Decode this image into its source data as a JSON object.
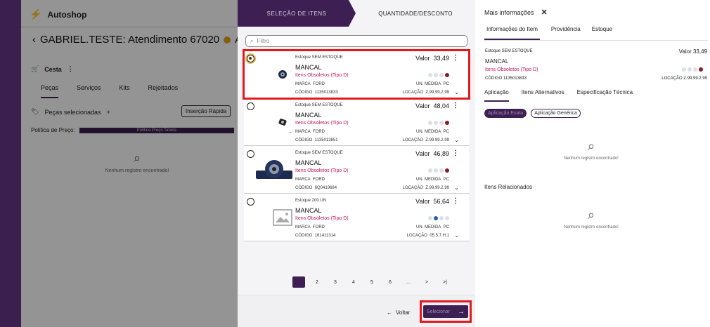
{
  "background": {
    "app_name": "Autoshop",
    "atendimento_title": "GABRIEL.TESTE: Atendimento 67020",
    "atendimento_suffix": "AI",
    "cesta_label": "Cesta",
    "tabs": [
      "Peças",
      "Serviços",
      "Kits",
      "Rejeitados"
    ],
    "pecas_selecionadas": "Peças selecionadas",
    "insercao_rapida": "Inserção Rápida",
    "politica_label": "Política de Preço:",
    "politica_value": "Política Preço Tabela",
    "empty_text": "Nenhum registro encontrado!"
  },
  "steps": {
    "step1": "SELEÇÃO DE ITENS",
    "step2": "QUANTIDADE/DESCONTO"
  },
  "filter": {
    "placeholder": "Filtro"
  },
  "items": [
    {
      "estoque": "Estoque SEM ESTOQUE",
      "nome": "MANCAL",
      "grupo": "Itens Obsoletos (Tipo D)",
      "marca_label": "MARCA",
      "marca": "FORD",
      "codigo_label": "CÓDIGO",
      "codigo": "1135013833",
      "valor_label": "Valor",
      "valor": "33,49",
      "unm_label": "UN. MEDIDA",
      "unm": "PC",
      "loc_label": "LOCAÇÃO",
      "loc": "Z.99.99.2.99",
      "dots": [
        "#d7e4d9",
        "#d8dfeb",
        "#e3dbe9",
        "#8b1b24"
      ]
    },
    {
      "estoque": "Estoque SEM ESTOQUE",
      "nome": "MANCAL",
      "grupo": "Itens Obsoletos (Tipo D)",
      "marca_label": "MARCA",
      "marca": "FORD",
      "codigo_label": "CÓDIGO",
      "codigo": "1135013851",
      "valor_label": "Valor",
      "valor": "48,04",
      "unm_label": "UN. MEDIDA",
      "unm": "PC",
      "loc_label": "LOCAÇÃO",
      "loc": "Z.99.99.2.99",
      "dots": [
        "#d7e4d9",
        "#d8dfeb",
        "#e3dbe9",
        "#8b1b24"
      ]
    },
    {
      "estoque": "Estoque SEM ESTOQUE",
      "nome": "MANCAL",
      "grupo": "Itens Obsoletos (Tipo D)",
      "marca_label": "MARCA",
      "marca": "FORD",
      "codigo_label": "CÓDIGO",
      "codigo": "6Q0419684",
      "valor_label": "Valor",
      "valor": "46,89",
      "unm_label": "UN. MEDIDA",
      "unm": "PC",
      "loc_label": "LOCAÇÃO",
      "loc": "Z.99.99.2.99",
      "dots": [
        "#d7e4d9",
        "#d8dfeb",
        "#e3dbe9",
        "#8b1b24"
      ]
    },
    {
      "estoque": "Estoque 200 UN",
      "nome": "MANCAL",
      "grupo": "Itens Obsoletos (Tipo D)",
      "marca_label": "MARCA",
      "marca": "FORD",
      "codigo_label": "CÓDIGO",
      "codigo": "161411314",
      "valor_label": "Valor",
      "valor": "56,64",
      "unm_label": "UN. MEDIDA",
      "unm": "PC",
      "loc_label": "LOCAÇÃO",
      "loc": "05.5.7.H.1",
      "dots": [
        "#d7e4d9",
        "#2a5db0",
        "#d8dfeb",
        "#e3dbe9"
      ]
    }
  ],
  "pager": [
    "1",
    "2",
    "3",
    "4",
    "5",
    "6",
    "...",
    ">",
    ">|"
  ],
  "footer": {
    "voltar": "Voltar",
    "selecionar": "Selecionar"
  },
  "detail": {
    "title": "Mais informações",
    "tabs": [
      "Informações do Item",
      "Providência",
      "Estoque"
    ],
    "estoque": "Estoque SEM ESTOQUE",
    "valor": "Valor 33,49",
    "nome": "MANCAL",
    "grupo": "Itens Obsoletos (Tipo D)",
    "codigo": "CÓDIGO 1135013833",
    "loc": "LOCAÇÃO Z.99.99.2.99",
    "subtabs": [
      "Aplicação",
      "Itens Alternativos",
      "Especificação Técnica"
    ],
    "chips": [
      "Aplicação Exata",
      "Aplicação Genérica"
    ],
    "empty_text": "Nenhum registro encontrado!",
    "related_title": "Itens Relacionados",
    "dots": [
      "#d7e4d9",
      "#d8dfeb",
      "#e3dbe9",
      "#8b1b24"
    ]
  }
}
